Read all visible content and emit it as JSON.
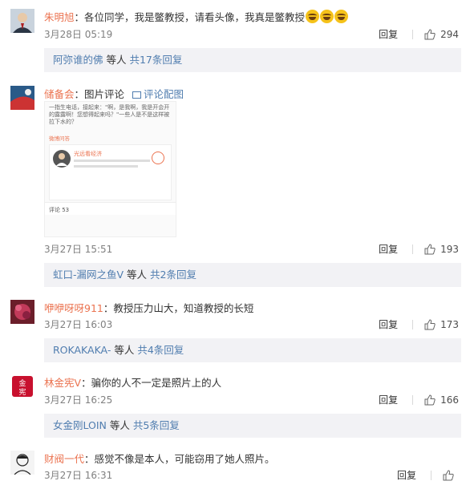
{
  "comments": [
    {
      "username": "朱明旭",
      "text": "：各位同学，我是鳖教授，请看头像，我真是鳖教授",
      "emoji": [
        "laughing-tears-emoji",
        "laughing-tears-emoji",
        "laughing-tears-emoji"
      ],
      "timestamp": "3月28日 05:19",
      "reply_label": "回复",
      "likes": "294",
      "sub_replies": {
        "first_user": "阿弥谁的佛",
        "suffix": " 等人 ",
        "count_text": "共17条回复"
      }
    },
    {
      "username": "储备会",
      "text": "：图片评论",
      "pic_link": "评论配图",
      "thumbnail": {
        "text": "一指生电话，接起来：\"啊，是我啊，我是开会开的露露啊！您想得起来吗？\"一些人是不是这样被拉下水的？",
        "label": "微博问答",
        "card_name": "光远看经济",
        "tabs": "评论 53"
      },
      "timestamp": "3月27日 15:51",
      "reply_label": "回复",
      "likes": "193",
      "sub_replies": {
        "first_user": "虹口-漏网之鱼V",
        "suffix": " 等人 ",
        "count_text": "共2条回复"
      }
    },
    {
      "username": "咿咿呀呀911",
      "text": "：教授压力山大，知道教授的长短",
      "timestamp": "3月27日 16:03",
      "reply_label": "回复",
      "likes": "173",
      "sub_replies": {
        "first_user": "ROKAKAKA-",
        "suffix": " 等人 ",
        "count_text": "共4条回复"
      }
    },
    {
      "username": "林金宪V",
      "text": "：骗你的人不一定是照片上的人",
      "timestamp": "3月27日 16:25",
      "reply_label": "回复",
      "likes": "166",
      "sub_replies": {
        "first_user": "女金刚LOIN",
        "suffix": " 等人 ",
        "count_text": "共5条回复"
      }
    },
    {
      "username": "财阀一代",
      "text": "：感觉不像是本人，可能窃用了她人照片。",
      "timestamp": "3月27日 16:31",
      "reply_label": "回复"
    }
  ],
  "colors": {
    "username": "#eb7350",
    "link": "#507daf",
    "meta": "#808080",
    "sub_bg": "#f2f2f5"
  },
  "icons": {
    "like": "thumbs-up-icon",
    "picture": "picture-icon"
  }
}
